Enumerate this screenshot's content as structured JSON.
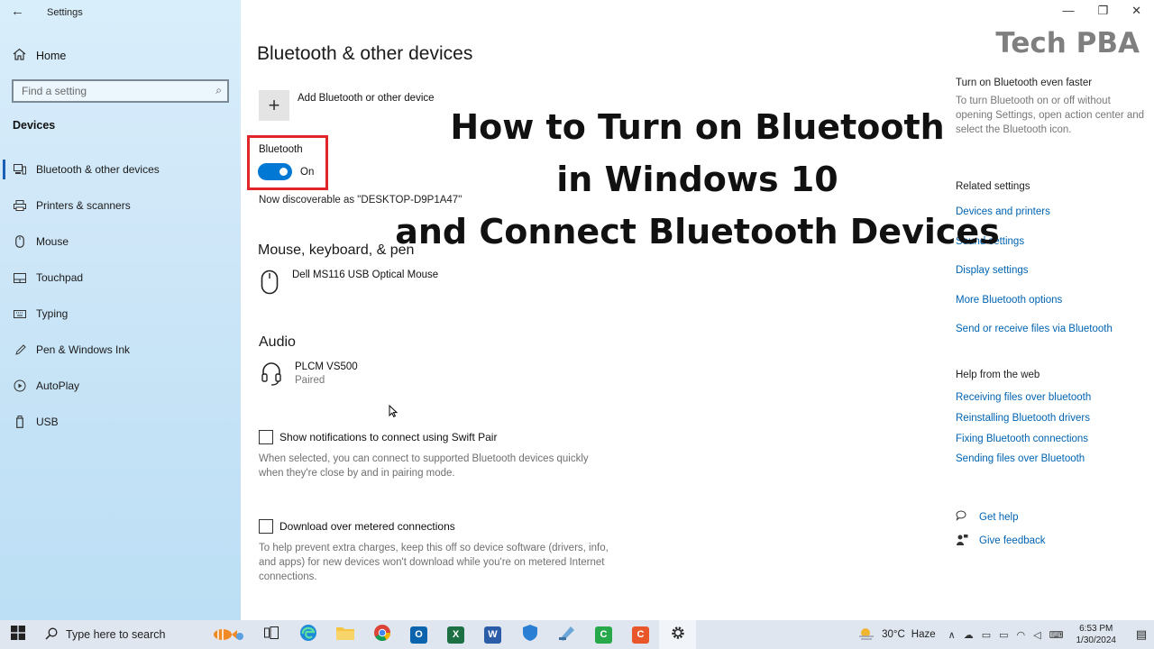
{
  "window": {
    "title": "Settings",
    "minimize": "—",
    "maximize": "❐",
    "close": "✕"
  },
  "sidebar": {
    "home": "Home",
    "search_placeholder": "Find a setting",
    "section": "Devices",
    "items": [
      {
        "label": "Bluetooth & other devices",
        "icon": "bluetooth-devices-icon",
        "active": true
      },
      {
        "label": "Printers & scanners",
        "icon": "printer-icon",
        "active": false
      },
      {
        "label": "Mouse",
        "icon": "mouse-icon",
        "active": false
      },
      {
        "label": "Touchpad",
        "icon": "touchpad-icon",
        "active": false
      },
      {
        "label": "Typing",
        "icon": "keyboard-icon",
        "active": false
      },
      {
        "label": "Pen & Windows Ink",
        "icon": "pen-icon",
        "active": false
      },
      {
        "label": "AutoPlay",
        "icon": "autoplay-icon",
        "active": false
      },
      {
        "label": "USB",
        "icon": "usb-icon",
        "active": false
      }
    ]
  },
  "main": {
    "title": "Bluetooth & other devices",
    "add_device": "Add Bluetooth or other device",
    "bluetooth_label": "Bluetooth",
    "bluetooth_state": "On",
    "discoverable": "Now discoverable as \"DESKTOP-D9P1A47\"",
    "mouse_section": "Mouse, keyboard, & pen",
    "mouse_device": "Dell MS116 USB Optical Mouse",
    "audio_section": "Audio",
    "audio_device": "PLCM VS500",
    "audio_status": "Paired",
    "swift_pair_label": "Show notifications to connect using Swift Pair",
    "swift_pair_desc": "When selected, you can connect to supported Bluetooth devices quickly when they're close by and in pairing mode.",
    "metered_label": "Download over metered connections",
    "metered_desc": "To help prevent extra charges, keep this off so device software (drivers, info, and apps) for new devices won't download while you're on metered Internet connections."
  },
  "overlay": {
    "line1": "How to Turn on Bluetooth",
    "line2": "in Windows 10",
    "line3": "and Connect Bluetooth Devices",
    "brand": "Tech PBA"
  },
  "right": {
    "faster_heading": "Turn on Bluetooth even faster",
    "faster_text": "To turn Bluetooth on or off without opening Settings, open action center and select the Bluetooth icon.",
    "related_heading": "Related settings",
    "related_links": [
      "Devices and printers",
      "Sound settings",
      "Display settings",
      "More Bluetooth options",
      "Send or receive files via Bluetooth"
    ],
    "help_heading": "Help from the web",
    "help_links": [
      "Receiving files over bluetooth",
      "Reinstalling Bluetooth drivers",
      "Fixing Bluetooth connections",
      "Sending files over Bluetooth"
    ],
    "get_help": "Get help",
    "give_feedback": "Give feedback"
  },
  "taskbar": {
    "search_placeholder": "Type here to search",
    "apps": [
      "task-view",
      "edge",
      "file-explorer",
      "chrome",
      "outlook",
      "excel",
      "word",
      "security",
      "app-blue",
      "camtasia-green",
      "camtasia-orange",
      "settings"
    ],
    "weather_temp": "30°C",
    "weather_text": "Haze",
    "time": "6:53 PM",
    "date": "1/30/2024"
  }
}
